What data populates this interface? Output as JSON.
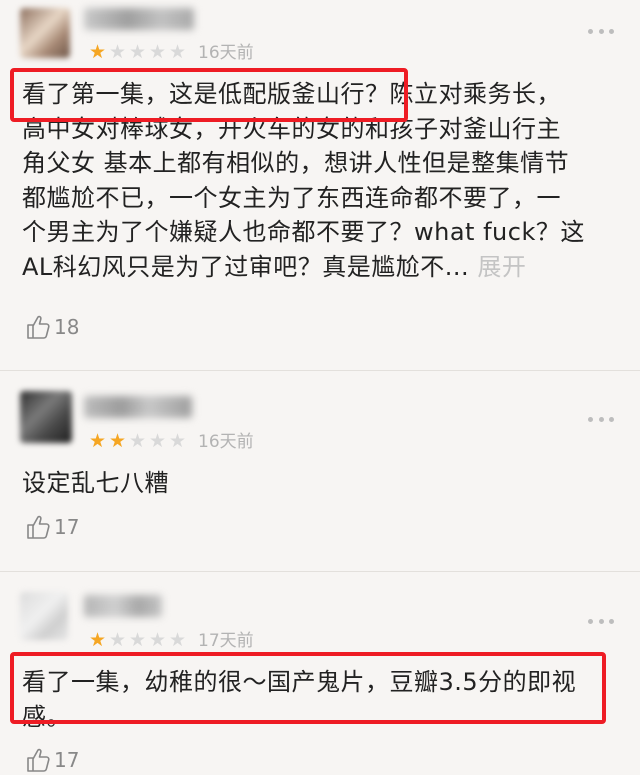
{
  "reviews": [
    {
      "rating": 1,
      "max_rating": 5,
      "time": "16天前",
      "text_lines": [
        "看了第一集，这是低配版釜山行？陈立对乘务长，",
        "高中女对棒球女，开火车的女的和孩子对釜山行主",
        "角父女 基本上都有相似的，想讲人性但是整集情节",
        "都尴尬不已，一个女主为了东西连命都不要了，一",
        "个男主为了个嫌疑人也命都不要了？what fuck？这",
        "AL科幻风只是为了过审吧？真是尴尬不..."
      ],
      "expand_label": "展开",
      "likes": "18"
    },
    {
      "rating": 2,
      "max_rating": 5,
      "time": "16天前",
      "text_lines": [
        "设定乱七八糟"
      ],
      "likes": "17"
    },
    {
      "rating": 1,
      "max_rating": 5,
      "time": "17天前",
      "text_lines": [
        "看了一集，幼稚的很～国产鬼片，豆瓣3.5分的即视",
        "感。"
      ],
      "likes": "17"
    }
  ],
  "colors": {
    "star_filled": "#f5a623",
    "star_empty": "#d9d9d9",
    "highlight_border": "#ee1c24"
  },
  "icons": {
    "like": "thumbs-up-icon",
    "more": "more-dots-icon"
  }
}
